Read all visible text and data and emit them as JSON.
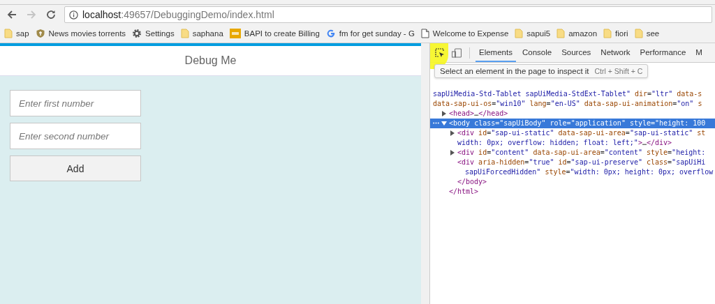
{
  "browser": {
    "back": {
      "disabled": false
    },
    "forward": {
      "disabled": true
    },
    "url": {
      "host": "localhost",
      "path": ":49657/DebuggingDemo/index.html"
    },
    "bookmarks": [
      {
        "kind": "folder",
        "label": "sap"
      },
      {
        "kind": "badge",
        "label": "News movies torrents"
      },
      {
        "kind": "gear",
        "label": "Settings"
      },
      {
        "kind": "folder",
        "label": "saphana"
      },
      {
        "kind": "scn",
        "label": "BAPI to create Billing"
      },
      {
        "kind": "google",
        "label": "fm for get sunday - G"
      },
      {
        "kind": "page",
        "label": "Welcome to Expense"
      },
      {
        "kind": "folder",
        "label": "sapui5"
      },
      {
        "kind": "folder",
        "label": "amazon"
      },
      {
        "kind": "folder",
        "label": "fiori"
      },
      {
        "kind": "folder",
        "label": "see"
      }
    ]
  },
  "app": {
    "title": "Debug Me",
    "fields": [
      {
        "placeholder": "Enter first number"
      },
      {
        "placeholder": "Enter second number"
      }
    ],
    "button": "Add"
  },
  "devtools": {
    "inspect": {
      "selected": true
    },
    "device": {
      "selected": false
    },
    "tabs": [
      {
        "label": "Elements",
        "selected": true
      },
      {
        "label": "Console",
        "selected": false
      },
      {
        "label": "Sources",
        "selected": false
      },
      {
        "label": "Network",
        "selected": false
      },
      {
        "label": "Performance",
        "selected": false
      },
      {
        "label": "M",
        "selected": false
      }
    ],
    "tooltip": {
      "text": "Select an element in the page to inspect it",
      "shortcut": "Ctrl + Shift + C"
    },
    "tree": [
      {
        "selected": false,
        "lines": [
          [
            {
              "kind": "val",
              "text": "sapUiMedia-Std-Tablet sapUiMedia-StdExt-Tablet\""
            },
            {
              "kind": "attr",
              "text": " dir"
            },
            {
              "kind": "p",
              "text": "="
            },
            {
              "kind": "val",
              "text": "\"ltr\""
            },
            {
              "kind": "attr",
              "text": " data-s"
            }
          ],
          [
            {
              "kind": "attr",
              "text": "data-sap-ui-os"
            },
            {
              "kind": "p",
              "text": "="
            },
            {
              "kind": "val",
              "text": "\"win10\""
            },
            {
              "kind": "attr",
              "text": " lang"
            },
            {
              "kind": "p",
              "text": "="
            },
            {
              "kind": "val",
              "text": "\"en-US\""
            },
            {
              "kind": "attr",
              "text": " data-sap-ui-animation"
            },
            {
              "kind": "p",
              "text": "="
            },
            {
              "kind": "val",
              "text": "\"on\""
            },
            {
              "kind": "attr",
              "text": " s"
            }
          ]
        ],
        "children": [
          {
            "kind": "toggle",
            "expanded": false,
            "selected": false,
            "lines": [
              [
                {
                  "kind": "tag",
                  "text": "<head>"
                },
                {
                  "kind": "p",
                  "text": "…"
                },
                {
                  "kind": "tag",
                  "text": "</head>"
                }
              ]
            ]
          },
          {
            "kind": "toggle",
            "expanded": true,
            "selected": true,
            "lines": [
              [
                {
                  "kind": "tag",
                  "text": "<body"
                },
                {
                  "kind": "attr",
                  "text": " class"
                },
                {
                  "kind": "p",
                  "text": "="
                },
                {
                  "kind": "val",
                  "text": "\"sapUiBody\""
                },
                {
                  "kind": "attr",
                  "text": " role"
                },
                {
                  "kind": "p",
                  "text": "="
                },
                {
                  "kind": "val",
                  "text": "\"application\""
                },
                {
                  "kind": "attr",
                  "text": " style"
                },
                {
                  "kind": "p",
                  "text": "="
                },
                {
                  "kind": "val",
                  "text": "\"height: 100"
                }
              ]
            ],
            "children": [
              {
                "kind": "toggle",
                "expanded": false,
                "selected": false,
                "lines": [
                  [
                    {
                      "kind": "tag",
                      "text": "<div"
                    },
                    {
                      "kind": "attr",
                      "text": " id"
                    },
                    {
                      "kind": "p",
                      "text": "="
                    },
                    {
                      "kind": "val",
                      "text": "\"sap-ui-static\""
                    },
                    {
                      "kind": "attr",
                      "text": " data-sap-ui-area"
                    },
                    {
                      "kind": "p",
                      "text": "="
                    },
                    {
                      "kind": "val",
                      "text": "\"sap-ui-static\""
                    },
                    {
                      "kind": "attr",
                      "text": " st"
                    }
                  ],
                  [
                    {
                      "kind": "val",
                      "text": "width: 0px; overflow: hidden; float: left;\""
                    },
                    {
                      "kind": "tag",
                      "text": ">"
                    },
                    {
                      "kind": "p",
                      "text": "…"
                    },
                    {
                      "kind": "tag",
                      "text": "</div>"
                    }
                  ]
                ]
              },
              {
                "kind": "toggle",
                "expanded": false,
                "selected": false,
                "lines": [
                  [
                    {
                      "kind": "tag",
                      "text": "<div"
                    },
                    {
                      "kind": "attr",
                      "text": " id"
                    },
                    {
                      "kind": "p",
                      "text": "="
                    },
                    {
                      "kind": "val",
                      "text": "\"content\""
                    },
                    {
                      "kind": "attr",
                      "text": " data-sap-ui-area"
                    },
                    {
                      "kind": "p",
                      "text": "="
                    },
                    {
                      "kind": "val",
                      "text": "\"content\""
                    },
                    {
                      "kind": "attr",
                      "text": " style"
                    },
                    {
                      "kind": "p",
                      "text": "="
                    },
                    {
                      "kind": "val",
                      "text": "\"height:"
                    }
                  ]
                ]
              },
              {
                "kind": "leaf",
                "selected": false,
                "lines": [
                  [
                    {
                      "kind": "tag",
                      "text": "<div"
                    },
                    {
                      "kind": "attr",
                      "text": " aria-hidden"
                    },
                    {
                      "kind": "p",
                      "text": "="
                    },
                    {
                      "kind": "val",
                      "text": "\"true\""
                    },
                    {
                      "kind": "attr",
                      "text": " id"
                    },
                    {
                      "kind": "p",
                      "text": "="
                    },
                    {
                      "kind": "val",
                      "text": "\"sap-ui-preserve\""
                    },
                    {
                      "kind": "attr",
                      "text": " class"
                    },
                    {
                      "kind": "p",
                      "text": "="
                    },
                    {
                      "kind": "val",
                      "text": "\"sapUiHi"
                    }
                  ],
                  [
                    {
                      "kind": "val",
                      "text": "sapUiForcedHidden\""
                    },
                    {
                      "kind": "attr",
                      "text": " style"
                    },
                    {
                      "kind": "p",
                      "text": "="
                    },
                    {
                      "kind": "val",
                      "text": "\"width: 0px; height: 0px; overflow"
                    }
                  ]
                ]
              },
              {
                "kind": "leaf",
                "selected": false,
                "lines": [
                  [
                    {
                      "kind": "tag",
                      "text": "</body>"
                    }
                  ]
                ]
              }
            ]
          },
          {
            "kind": "leaf",
            "selected": false,
            "lines": [
              [
                {
                  "kind": "tag",
                  "text": "</html>"
                }
              ]
            ]
          }
        ]
      }
    ]
  }
}
